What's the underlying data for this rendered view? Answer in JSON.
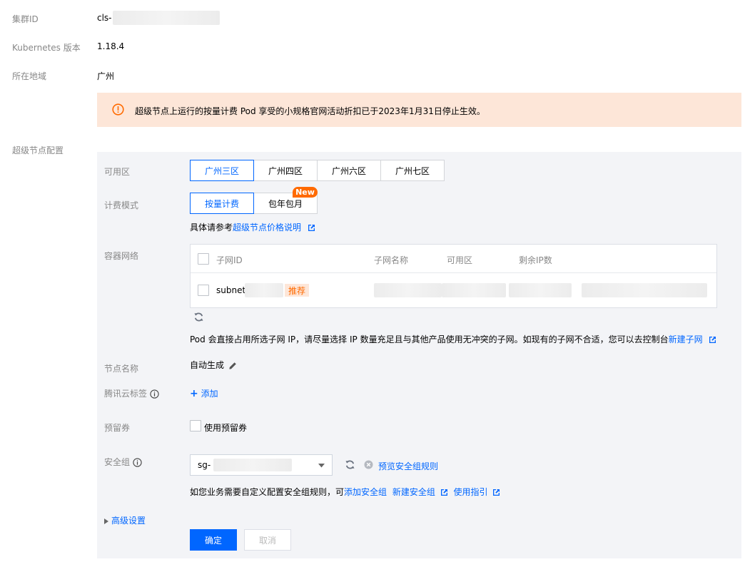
{
  "info": {
    "cluster_id_label": "集群ID",
    "cluster_id_value": "cls-",
    "k8s_label": "Kubernetes 版本",
    "k8s_value": "1.18.4",
    "region_label": "所在地域",
    "region_value": "广州"
  },
  "notice": {
    "text": "超级节点上运行的按量计费 Pod 享受的小规格官网活动折扣已于2023年1月31日停止生效。"
  },
  "section": {
    "title": "超级节点配置"
  },
  "zone": {
    "label": "可用区",
    "options": [
      "广州三区",
      "广州四区",
      "广州六区",
      "广州七区"
    ]
  },
  "billing": {
    "label": "计费模式",
    "options": [
      "按量计费",
      "包年包月"
    ],
    "new_badge": "New",
    "hint_prefix": "具体请参考",
    "hint_link": "超级节点价格说明"
  },
  "network": {
    "label": "容器网络",
    "columns": [
      "子网ID",
      "子网名称",
      "可用区",
      "剩余IP数"
    ],
    "row": {
      "subnet_prefix": "subnet",
      "recommend_tag": "推荐"
    },
    "hint_text": "Pod 会直接占用所选子网 IP，请尽量选择 IP 数量充足且与其他产品使用无冲突的子网。如现有的子网不合适，您可以去控制台",
    "hint_link": "新建子网"
  },
  "node_name": {
    "label": "节点名称",
    "value": "自动生成"
  },
  "tags": {
    "label": "腾讯云标签",
    "add_label": "添加"
  },
  "reserved": {
    "label": "预留券",
    "checkbox_label": "使用预留券"
  },
  "security_group": {
    "label": "安全组",
    "selected": "sg-",
    "preview_link": "预览安全组规则",
    "hint_text": "如您业务需要自定义配置安全组规则，可",
    "add_link": "添加安全组",
    "new_link": "新建安全组",
    "guide_link": "使用指引"
  },
  "advanced": {
    "label": "高级设置"
  },
  "actions": {
    "confirm": "确定",
    "cancel": "取消"
  },
  "colors": {
    "primary": "#0066ff",
    "warning": "#ff6a00",
    "notice_bg": "#fde6d8",
    "panel_bg": "#f3f4f7"
  }
}
